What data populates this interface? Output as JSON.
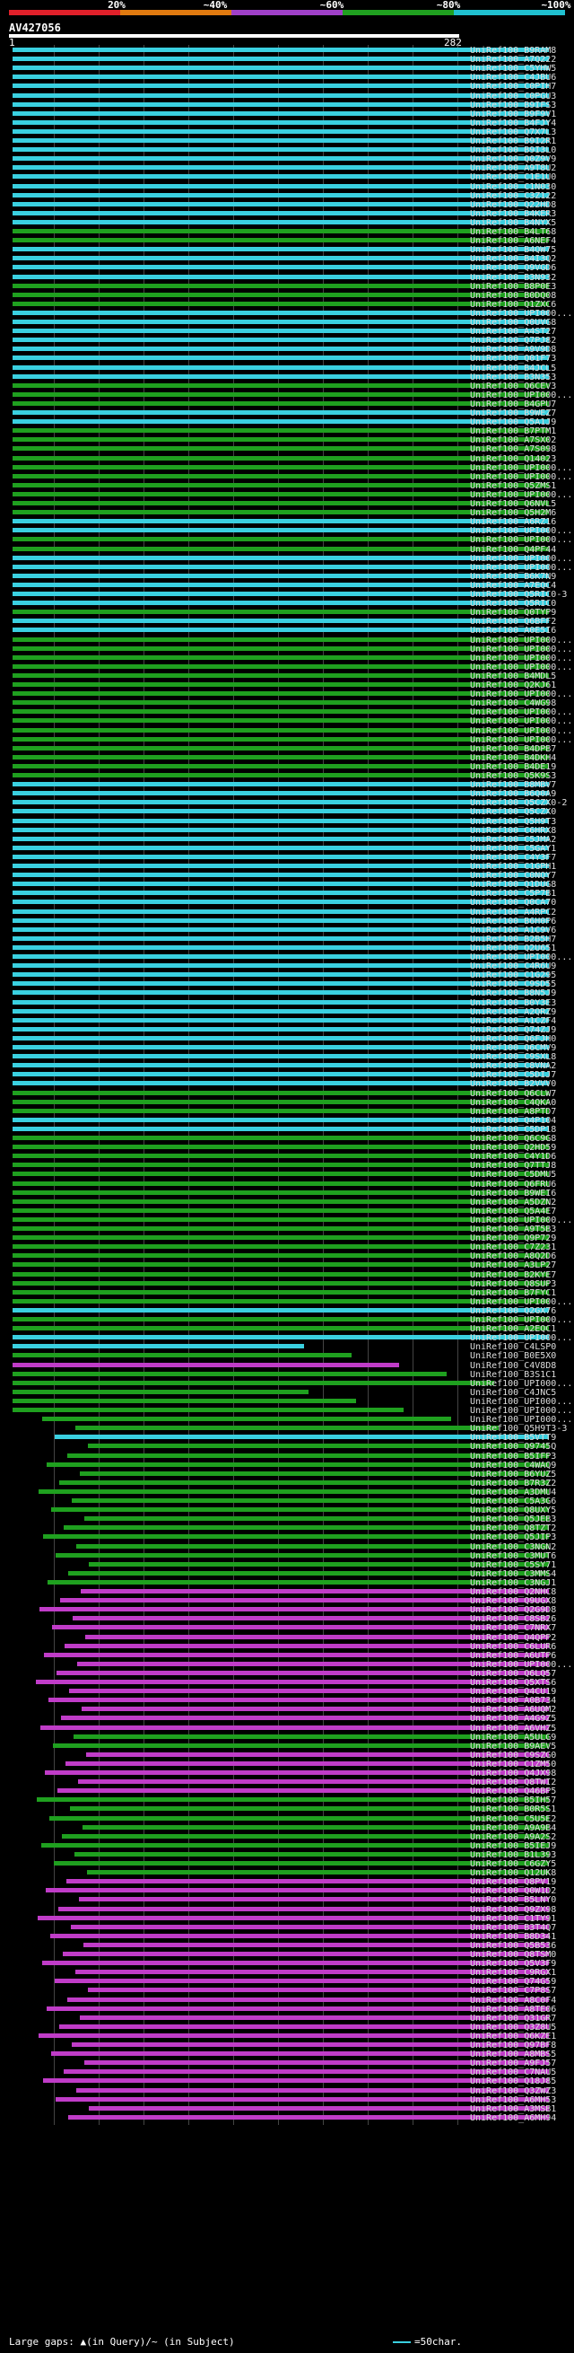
{
  "legend": {
    "ticks": [
      "20%",
      "~40%",
      "~60%",
      "~80%",
      "~100%"
    ],
    "colors": [
      "#e0202a",
      "#e07a10",
      "#a040c8",
      "#20a020",
      "#20c0d0"
    ]
  },
  "query": {
    "id": "AV427056",
    "start": "1",
    "end": "282"
  },
  "footer": {
    "gaps": "Large gaps: ▲(in Query)/~ (in Subject)",
    "scale": "=50char."
  },
  "hits": [
    {
      "label": "UniRef100_B9RAM8",
      "color": "cyan"
    },
    {
      "label": "UniRef100_A7Q222",
      "color": "cyan"
    },
    {
      "label": "UniRef100_C5YHW5",
      "color": "cyan"
    },
    {
      "label": "UniRef100_C4JBU6",
      "color": "cyan"
    },
    {
      "label": "UniRef100_C0PIH7",
      "color": "cyan"
    },
    {
      "label": "UniRef100_C0PGU3",
      "color": "cyan"
    },
    {
      "label": "UniRef100_B9IFS3",
      "color": "cyan"
    },
    {
      "label": "UniRef100_B9F9V1",
      "color": "cyan"
    },
    {
      "label": "UniRef100_B4FJY4",
      "color": "cyan"
    },
    {
      "label": "UniRef100_Q7X7L3",
      "color": "cyan"
    },
    {
      "label": "UniRef100_B9I2R1",
      "color": "cyan"
    },
    {
      "label": "UniRef100_B9I3L0",
      "color": "cyan"
    },
    {
      "label": "UniRef100_Q0Z9V9",
      "color": "cyan"
    },
    {
      "label": "UniRef100_A9T8U2",
      "color": "cyan"
    },
    {
      "label": "UniRef100_C1E1U0",
      "color": "cyan"
    },
    {
      "label": "UniRef100_C1N030",
      "color": "cyan"
    },
    {
      "label": "UniRef100_C3Z122",
      "color": "cyan"
    },
    {
      "label": "UniRef100_Q22HD8",
      "color": "cyan"
    },
    {
      "label": "UniRef100_B4KER3",
      "color": "cyan"
    },
    {
      "label": "UniRef100_B4NYX5",
      "color": "cyan"
    },
    {
      "label": "UniRef100_B4LT68",
      "color": "green"
    },
    {
      "label": "UniRef100_A6NEF4",
      "color": "green"
    },
    {
      "label": "UniRef100_B4QW75",
      "color": "cyan"
    },
    {
      "label": "UniRef100_B4I3Q2",
      "color": "cyan"
    },
    {
      "label": "UniRef100_Q9VGD6",
      "color": "cyan"
    },
    {
      "label": "UniRef100_B3N932",
      "color": "cyan"
    },
    {
      "label": "UniRef100_B8P0E3",
      "color": "green"
    },
    {
      "label": "UniRef100_B0DQ08",
      "color": "green"
    },
    {
      "label": "UniRef100_Q1ZXC6",
      "color": "green"
    },
    {
      "label": "UniRef100_UPI000...",
      "color": "cyan"
    },
    {
      "label": "UniRef100_Q0UVG8",
      "color": "cyan"
    },
    {
      "label": "UniRef100_A4ST27",
      "color": "cyan"
    },
    {
      "label": "UniRef100_Q7PJ82",
      "color": "cyan"
    },
    {
      "label": "UniRef100_A9V9D8",
      "color": "cyan"
    },
    {
      "label": "UniRef100_Q01F73",
      "color": "cyan"
    },
    {
      "label": "UniRef100_B4JCL5",
      "color": "cyan"
    },
    {
      "label": "UniRef100_B3N353",
      "color": "cyan"
    },
    {
      "label": "UniRef100_Q6CEV3",
      "color": "green"
    },
    {
      "label": "UniRef100_UPI000...",
      "color": "green"
    },
    {
      "label": "UniRef100_B4GPU7",
      "color": "green"
    },
    {
      "label": "UniRef100_B9WEZ7",
      "color": "cyan"
    },
    {
      "label": "UniRef100_Q5A1J9",
      "color": "cyan"
    },
    {
      "label": "UniRef100_B7PTM1",
      "color": "green"
    },
    {
      "label": "UniRef100_A7SX02",
      "color": "green"
    },
    {
      "label": "UniRef100_A7S098",
      "color": "green"
    },
    {
      "label": "UniRef100_Q14023",
      "color": "green"
    },
    {
      "label": "UniRef100_UPI000...",
      "color": "green"
    },
    {
      "label": "UniRef100_UPI000...",
      "color": "green"
    },
    {
      "label": "UniRef100_Q5ZMS1",
      "color": "green"
    },
    {
      "label": "UniRef100_UPI000...",
      "color": "green"
    },
    {
      "label": "UniRef100_Q6NVL5",
      "color": "green"
    },
    {
      "label": "UniRef100_Q5H2M6",
      "color": "green"
    },
    {
      "label": "UniRef100_A6RZ16",
      "color": "cyan"
    },
    {
      "label": "UniRef100_UPI000...",
      "color": "cyan"
    },
    {
      "label": "UniRef100_UPI000...",
      "color": "green"
    },
    {
      "label": "UniRef100_Q4PF44",
      "color": "green"
    },
    {
      "label": "UniRef100_UPI000...",
      "color": "cyan"
    },
    {
      "label": "UniRef100_UPI000...",
      "color": "cyan"
    },
    {
      "label": "UniRef100_B6K7N9",
      "color": "cyan"
    },
    {
      "label": "UniRef100_A7EQC4",
      "color": "cyan"
    },
    {
      "label": "UniRef100_Q5RIC0-3",
      "color": "cyan"
    },
    {
      "label": "UniRef100_Q5RIC0",
      "color": "cyan"
    },
    {
      "label": "UniRef100_Q0TYP9",
      "color": "green"
    },
    {
      "label": "UniRef100_Q6BFF2",
      "color": "cyan"
    },
    {
      "label": "UniRef100_A0E5I6",
      "color": "cyan"
    },
    {
      "label": "UniRef100_UPI000...",
      "color": "green"
    },
    {
      "label": "UniRef100_UPI000...",
      "color": "green"
    },
    {
      "label": "UniRef100_UPI000...",
      "color": "green"
    },
    {
      "label": "UniRef100_UPI000...",
      "color": "green"
    },
    {
      "label": "UniRef100_B4MDL5",
      "color": "green"
    },
    {
      "label": "UniRef100_Q2KJ61",
      "color": "green"
    },
    {
      "label": "UniRef100_UPI000...",
      "color": "green"
    },
    {
      "label": "UniRef100_C4WG98",
      "color": "green"
    },
    {
      "label": "UniRef100_UPI000...",
      "color": "green"
    },
    {
      "label": "UniRef100_UPI000...",
      "color": "green"
    },
    {
      "label": "UniRef100_UPI000...",
      "color": "green"
    },
    {
      "label": "UniRef100_UPI000...",
      "color": "green"
    },
    {
      "label": "UniRef100_B4DPB7",
      "color": "green"
    },
    {
      "label": "UniRef100_B4DKH4",
      "color": "green"
    },
    {
      "label": "UniRef100_B4DE19",
      "color": "green"
    },
    {
      "label": "UniRef100_Q5K9S3",
      "color": "green"
    },
    {
      "label": "UniRef100_B8MBV7",
      "color": "cyan"
    },
    {
      "label": "UniRef100_B6Q0A9",
      "color": "cyan"
    },
    {
      "label": "UniRef100_Q5CZX0-2",
      "color": "cyan"
    },
    {
      "label": "UniRef100_Q5CZX0",
      "color": "cyan"
    },
    {
      "label": "UniRef100_Q5H9T3",
      "color": "cyan"
    },
    {
      "label": "UniRef100_C6HRX8",
      "color": "cyan"
    },
    {
      "label": "UniRef100_C5JMA2",
      "color": "cyan"
    },
    {
      "label": "UniRef100_C5GAY1",
      "color": "cyan"
    },
    {
      "label": "UniRef100_C4Y3F7",
      "color": "cyan"
    },
    {
      "label": "UniRef100_C1GPH1",
      "color": "cyan"
    },
    {
      "label": "UniRef100_C0NQY7",
      "color": "cyan"
    },
    {
      "label": "UniRef100_Q1DUG8",
      "color": "cyan"
    },
    {
      "label": "UniRef100_C5P7B1",
      "color": "cyan"
    },
    {
      "label": "UniRef100_Q0CA70",
      "color": "cyan"
    },
    {
      "label": "UniRef100_A4RPC2",
      "color": "cyan"
    },
    {
      "label": "UniRef100_B6H0P6",
      "color": "cyan"
    },
    {
      "label": "UniRef100_A1C9V6",
      "color": "cyan"
    },
    {
      "label": "UniRef100_B2B5H7",
      "color": "cyan"
    },
    {
      "label": "UniRef100_Q2U651",
      "color": "cyan"
    },
    {
      "label": "UniRef100_UPI000...",
      "color": "cyan"
    },
    {
      "label": "UniRef100_C4R6U9",
      "color": "cyan"
    },
    {
      "label": "UniRef100_C1G295",
      "color": "cyan"
    },
    {
      "label": "UniRef100_C9SD55",
      "color": "cyan"
    },
    {
      "label": "UniRef100_B8N5J9",
      "color": "cyan"
    },
    {
      "label": "UniRef100_B0Y3E3",
      "color": "cyan"
    },
    {
      "label": "UniRef100_A2QRZ9",
      "color": "cyan"
    },
    {
      "label": "UniRef100_A1CZF4",
      "color": "cyan"
    },
    {
      "label": "UniRef100_Q74ZJ9",
      "color": "cyan"
    },
    {
      "label": "UniRef100_Q6FJH0",
      "color": "cyan"
    },
    {
      "label": "UniRef100_Q6CMV9",
      "color": "cyan"
    },
    {
      "label": "UniRef100_C9SXL8",
      "color": "cyan"
    },
    {
      "label": "UniRef100_C8VNA2",
      "color": "cyan"
    },
    {
      "label": "UniRef100_C5DIJ7",
      "color": "cyan"
    },
    {
      "label": "UniRef100_B2VVV0",
      "color": "cyan"
    },
    {
      "label": "UniRef100_Q6CLW7",
      "color": "green"
    },
    {
      "label": "UniRef100_C4QKA0",
      "color": "green"
    },
    {
      "label": "UniRef100_A8PTD7",
      "color": "green"
    },
    {
      "label": "UniRef100_Q4P104",
      "color": "cyan"
    },
    {
      "label": "UniRef100_C5DP18",
      "color": "cyan"
    },
    {
      "label": "UniRef100_Q6C9G8",
      "color": "green"
    },
    {
      "label": "UniRef100_Q2HD59",
      "color": "green"
    },
    {
      "label": "UniRef100_C4Y1D6",
      "color": "green"
    },
    {
      "label": "UniRef100_Q7TTJ8",
      "color": "green"
    },
    {
      "label": "UniRef100_C5DMU5",
      "color": "green"
    },
    {
      "label": "UniRef100_Q6FRU6",
      "color": "green"
    },
    {
      "label": "UniRef100_B9WEI6",
      "color": "green"
    },
    {
      "label": "UniRef100_A5DZN2",
      "color": "green"
    },
    {
      "label": "UniRef100_Q5A4E7",
      "color": "green"
    },
    {
      "label": "UniRef100_UPI000...",
      "color": "green"
    },
    {
      "label": "UniRef100_A9T5B3",
      "color": "green"
    },
    {
      "label": "UniRef100_Q9P729",
      "color": "green"
    },
    {
      "label": "UniRef100_C7Z231",
      "color": "green"
    },
    {
      "label": "UniRef100_A8Q2D6",
      "color": "green"
    },
    {
      "label": "UniRef100_A3LP27",
      "color": "green"
    },
    {
      "label": "UniRef100_B2KYE7",
      "color": "green"
    },
    {
      "label": "UniRef100_Q8SUP3",
      "color": "green"
    },
    {
      "label": "UniRef100_B7FYC1",
      "color": "green"
    },
    {
      "label": "UniRef100_UPI000...",
      "color": "green"
    },
    {
      "label": "UniRef100_Q2GX76",
      "color": "cyan"
    },
    {
      "label": "UniRef100_UPI000...",
      "color": "green"
    },
    {
      "label": "UniRef100_A2EQC1",
      "color": "green"
    },
    {
      "label": "UniRef100_UPI000...",
      "color": "cyan"
    },
    {
      "label": "UniRef100_C4LSP0",
      "color": "cyan"
    },
    {
      "label": "UniRef100_B0E5X0",
      "color": "green"
    },
    {
      "label": "UniRef100_C4V8D8",
      "color": "magenta"
    },
    {
      "label": "UniRef100_B3S1C1",
      "color": "green"
    },
    {
      "label": "UniRef100_UPI000...",
      "color": "green"
    },
    {
      "label": "UniRef100_C4JNC5",
      "color": "green"
    },
    {
      "label": "UniRef100_UPI000...",
      "color": "green"
    },
    {
      "label": "UniRef100_UPI000...",
      "color": "green"
    },
    {
      "label": "UniRef100_UPI000...",
      "color": "green"
    },
    {
      "label": "UniRef100_Q5H9T3-3",
      "color": "green"
    },
    {
      "label": "UniRef100_B5VTT9",
      "color": "cyan"
    },
    {
      "label": "UniRef100_Q9745Q",
      "color": "green"
    },
    {
      "label": "UniRef100_B5IFP3",
      "color": "green"
    },
    {
      "label": "UniRef100_C4WAQ9",
      "color": "green"
    },
    {
      "label": "UniRef100_B6YUZ5",
      "color": "green"
    },
    {
      "label": "UniRef100_B7R3Z2",
      "color": "green"
    },
    {
      "label": "UniRef100_A3DMU4",
      "color": "green"
    },
    {
      "label": "UniRef100_C5A3G6",
      "color": "green"
    },
    {
      "label": "UniRef100_Q8UXY5",
      "color": "green"
    },
    {
      "label": "UniRef100_Q5JEB3",
      "color": "green"
    },
    {
      "label": "UniRef100_Q8TZT2",
      "color": "green"
    },
    {
      "label": "UniRef100_Q5JIP3",
      "color": "green"
    },
    {
      "label": "UniRef100_C3NGN2",
      "color": "green"
    },
    {
      "label": "UniRef100_C3MUT6",
      "color": "green"
    },
    {
      "label": "UniRef100_C5SY71",
      "color": "green"
    },
    {
      "label": "UniRef100_C3MMS4",
      "color": "green"
    },
    {
      "label": "UniRef100_C3NGJ1",
      "color": "green"
    },
    {
      "label": "UniRef100_Q2NHC8",
      "color": "magenta"
    },
    {
      "label": "UniRef100_Q9UGX8",
      "color": "magenta"
    },
    {
      "label": "UniRef100_Q2G9D8",
      "color": "magenta"
    },
    {
      "label": "UniRef100_C8SB26",
      "color": "magenta"
    },
    {
      "label": "UniRef100_C7NRX7",
      "color": "magenta"
    },
    {
      "label": "UniRef100_Q4QPP2",
      "color": "magenta"
    },
    {
      "label": "UniRef100_C6LUR6",
      "color": "magenta"
    },
    {
      "label": "UniRef100_A6UTP6",
      "color": "magenta"
    },
    {
      "label": "UniRef100_UPI000...",
      "color": "magenta"
    },
    {
      "label": "UniRef100_Q6LQ57",
      "color": "magenta"
    },
    {
      "label": "UniRef100_Q5XTS6",
      "color": "magenta"
    },
    {
      "label": "UniRef100_Q4CU19",
      "color": "magenta"
    },
    {
      "label": "UniRef100_A0B734",
      "color": "magenta"
    },
    {
      "label": "UniRef100_A6UQM2",
      "color": "magenta"
    },
    {
      "label": "UniRef100_A4G9Z5",
      "color": "magenta"
    },
    {
      "label": "UniRef100_A6VHZ5",
      "color": "magenta"
    },
    {
      "label": "UniRef100_A5ULG9",
      "color": "green"
    },
    {
      "label": "UniRef100_B9AEV5",
      "color": "green"
    },
    {
      "label": "UniRef100_C9SZG0",
      "color": "magenta"
    },
    {
      "label": "UniRef100_C1ZM50",
      "color": "magenta"
    },
    {
      "label": "UniRef100_Q4JX98",
      "color": "magenta"
    },
    {
      "label": "UniRef100_Q8TWI2",
      "color": "magenta"
    },
    {
      "label": "UniRef100_Q46BP5",
      "color": "magenta"
    },
    {
      "label": "UniRef100_B5IH57",
      "color": "green"
    },
    {
      "label": "UniRef100_B0R5S1",
      "color": "green"
    },
    {
      "label": "UniRef100_C5U5E2",
      "color": "green"
    },
    {
      "label": "UniRef100_A9A9B4",
      "color": "green"
    },
    {
      "label": "UniRef100_A9A2S2",
      "color": "green"
    },
    {
      "label": "UniRef100_B5IEJ9",
      "color": "green"
    },
    {
      "label": "UniRef100_B1L393",
      "color": "green"
    },
    {
      "label": "UniRef100_C6GZY5",
      "color": "green"
    },
    {
      "label": "UniRef100_Q12UK8",
      "color": "green"
    },
    {
      "label": "UniRef100_Q8PV19",
      "color": "magenta"
    },
    {
      "label": "UniRef100_Q0W1D2",
      "color": "magenta"
    },
    {
      "label": "UniRef100_B5LNY0",
      "color": "magenta"
    },
    {
      "label": "UniRef100_Q9ZX98",
      "color": "magenta"
    },
    {
      "label": "UniRef100_C1TY91",
      "color": "magenta"
    },
    {
      "label": "UniRef100_B3T4Q7",
      "color": "magenta"
    },
    {
      "label": "UniRef100_B8D341",
      "color": "magenta"
    },
    {
      "label": "UniRef100_Q5B536",
      "color": "magenta"
    },
    {
      "label": "UniRef100_Q8TSM0",
      "color": "magenta"
    },
    {
      "label": "UniRef100_Q5V3F9",
      "color": "magenta"
    },
    {
      "label": "UniRef100_C9RGX1",
      "color": "magenta"
    },
    {
      "label": "UniRef100_Q74G59",
      "color": "magenta"
    },
    {
      "label": "UniRef100_C7P8S7",
      "color": "magenta"
    },
    {
      "label": "UniRef100_A8C0F4",
      "color": "magenta"
    },
    {
      "label": "UniRef100_A8TE06",
      "color": "magenta"
    },
    {
      "label": "UniRef100_Q31GR7",
      "color": "magenta"
    },
    {
      "label": "UniRef100_Q3Z8U5",
      "color": "magenta"
    },
    {
      "label": "UniRef100_Q6KZE1",
      "color": "magenta"
    },
    {
      "label": "UniRef100_Q97BF8",
      "color": "magenta"
    },
    {
      "label": "UniRef100_A8MBS5",
      "color": "magenta"
    },
    {
      "label": "UniRef100_A9FJ57",
      "color": "magenta"
    },
    {
      "label": "UniRef100_C7NAU5",
      "color": "magenta"
    },
    {
      "label": "UniRef100_Q18J85",
      "color": "magenta"
    },
    {
      "label": "UniRef100_Q3ZWZ3",
      "color": "magenta"
    },
    {
      "label": "UniRef100_A6MH53",
      "color": "magenta"
    },
    {
      "label": "UniRef100_A3MSB1",
      "color": "magenta"
    },
    {
      "label": "UniRef100_A6MH94",
      "color": "magenta"
    }
  ]
}
